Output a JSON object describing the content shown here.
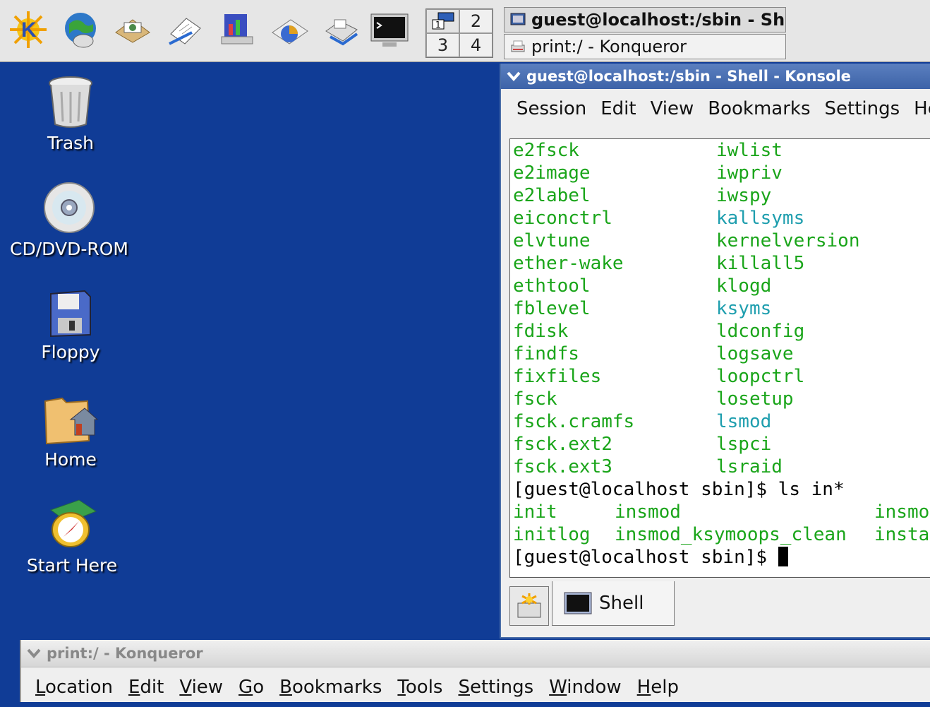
{
  "panel": {
    "launchers": [
      "kde-menu-icon",
      "web-browser-icon",
      "email-icon",
      "writer-icon",
      "presentation-icon",
      "spreadsheet-icon",
      "printer-icon",
      "terminal-icon"
    ],
    "pager": [
      "1",
      "2",
      "3",
      "4"
    ],
    "tasks": [
      {
        "label": "guest@localhost:/sbin - Shell - Konsole",
        "icon": "konsole-icon"
      },
      {
        "label": "print:/ - Konqueror",
        "icon": "printer-icon"
      }
    ]
  },
  "desktop": {
    "icons": [
      {
        "label": "Trash",
        "icon": "trash-icon"
      },
      {
        "label": "CD/DVD-ROM",
        "icon": "cdrom-icon"
      },
      {
        "label": "Floppy",
        "icon": "floppy-icon"
      },
      {
        "label": "Home",
        "icon": "home-folder-icon"
      },
      {
        "label": "Start Here",
        "icon": "start-here-icon"
      }
    ]
  },
  "konsole": {
    "title": "guest@localhost:/sbin - Shell - Konsole",
    "menu": [
      "Session",
      "Edit",
      "View",
      "Bookmarks",
      "Settings",
      "Help"
    ],
    "ls_rows": [
      {
        "left": "e2fsck",
        "right": "iwlist",
        "rc": "g"
      },
      {
        "left": "e2image",
        "right": "iwpriv",
        "rc": "g"
      },
      {
        "left": "e2label",
        "right": "iwspy",
        "rc": "g"
      },
      {
        "left": "eiconctrl",
        "right": "kallsyms",
        "rc": "c"
      },
      {
        "left": "elvtune",
        "right": "kernelversion",
        "rc": "g"
      },
      {
        "left": "ether-wake",
        "right": "killall5",
        "rc": "g"
      },
      {
        "left": "ethtool",
        "right": "klogd",
        "rc": "g"
      },
      {
        "left": "fblevel",
        "right": "ksyms",
        "rc": "c"
      },
      {
        "left": "fdisk",
        "right": "ldconfig",
        "rc": "g"
      },
      {
        "left": "findfs",
        "right": "logsave",
        "rc": "g"
      },
      {
        "left": "fixfiles",
        "right": "loopctrl",
        "rc": "g"
      },
      {
        "left": "fsck",
        "right": "losetup",
        "rc": "g"
      },
      {
        "left": "fsck.cramfs",
        "right": "lsmod",
        "rc": "c"
      },
      {
        "left": "fsck.ext2",
        "right": "lspci",
        "rc": "g"
      },
      {
        "left": "fsck.ext3",
        "right": "lsraid",
        "rc": "g"
      }
    ],
    "cmd": "[guest@localhost sbin]$ ls in*",
    "in_rows": [
      [
        "init",
        "insmod",
        "insmo"
      ],
      [
        "initlog",
        "insmod_ksymoops_clean",
        "insta"
      ]
    ],
    "prompt": "[guest@localhost sbin]$ ",
    "tab_label": "Shell"
  },
  "konqueror": {
    "title": "print:/ - Konqueror",
    "menu": [
      {
        "u": "L",
        "rest": "ocation"
      },
      {
        "u": "E",
        "rest": "dit"
      },
      {
        "u": "V",
        "rest": "iew"
      },
      {
        "u": "G",
        "rest": "o"
      },
      {
        "u": "B",
        "rest": "ookmarks"
      },
      {
        "u": "T",
        "rest": "ools"
      },
      {
        "u": "S",
        "rest": "ettings"
      },
      {
        "u": "W",
        "rest": "indow"
      },
      {
        "u": "H",
        "rest": "elp"
      }
    ]
  }
}
